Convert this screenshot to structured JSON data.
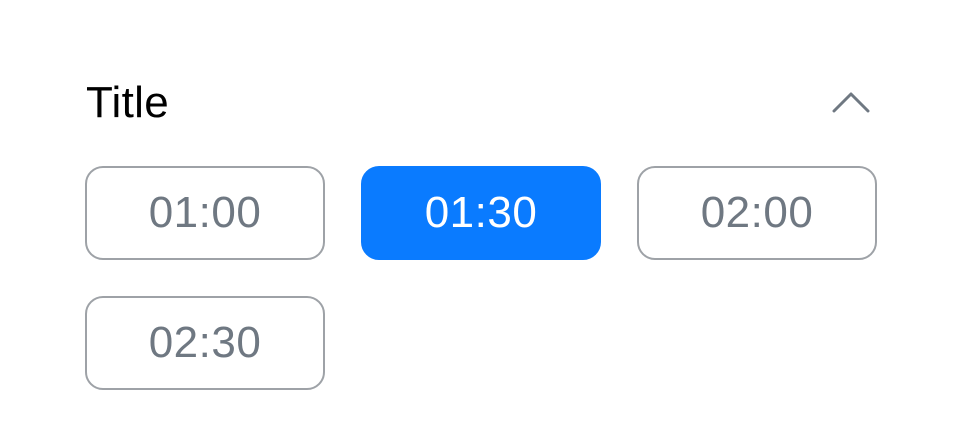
{
  "section": {
    "title": "Title",
    "collapse_icon": "chevron-up-icon",
    "slots": [
      {
        "label": "01:00",
        "selected": false
      },
      {
        "label": "01:30",
        "selected": true
      },
      {
        "label": "02:00",
        "selected": false
      },
      {
        "label": "02:30",
        "selected": false
      }
    ]
  },
  "colors": {
    "accent": "#0a7bff",
    "slot_border": "#9ea2a7",
    "slot_text": "#6f7882",
    "title_text": "#000000",
    "icon": "#6f7882"
  }
}
